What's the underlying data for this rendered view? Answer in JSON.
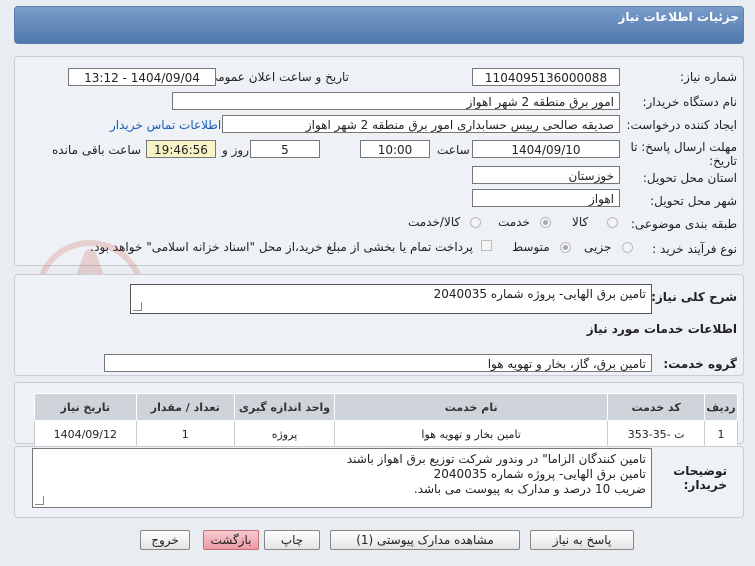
{
  "header": {
    "title": "جزئیات اطلاعات نیاز"
  },
  "form": {
    "need_number_label": "شماره نیاز:",
    "need_number": "1104095136000088",
    "announce_label": "تاریخ و ساعت اعلان عمومی:",
    "announce_value": "1404/09/04 - 13:12",
    "buyer_org_label": "نام دستگاه خریدار:",
    "buyer_org": "امور برق منطقه 2 شهر اهواز",
    "creator_label": "ایجاد کننده درخواست:",
    "creator": "صدیقه صالحی رییس حسابداری امور برق منطقه 2 شهر اهواز",
    "contact_link": "اطلاعات تماس خریدار",
    "deadline_label_1": "مهلت ارسال پاسخ: تا",
    "deadline_label_2": "تاریخ:",
    "deadline_date": "1404/09/10",
    "time_label": "ساعت",
    "deadline_time": "10:00",
    "days_value": "5",
    "days_label": "روز و",
    "remaining_time": "19:46:56",
    "remaining_label": "ساعت باقی مانده",
    "province_label": "استان محل تحویل:",
    "province": "خوزستان",
    "city_label": "شهر محل تحویل:",
    "city": "اهواز",
    "category_label": "طبقه بندی موضوعی:",
    "category_options": [
      "کالا",
      "خدمت",
      "کالا/خدمت"
    ],
    "purchase_type_label": "نوع فرآیند خرید :",
    "purchase_options": [
      "جزیی",
      "متوسط"
    ],
    "payment_note": "پرداخت تمام یا بخشی از مبلغ خرید،از محل \"اسناد خزانه اسلامی\" خواهد بود."
  },
  "description": {
    "label": "شرح کلی نیاز:",
    "value": "تامین برق الهایی- پروژه شماره 2040035"
  },
  "services": {
    "section_title": "اطلاعات خدمات مورد نیاز",
    "group_label": "گروه خدمت:",
    "group_value": "تامین برق، گاز، بخار و تهویه هوا",
    "columns": [
      "ردیف",
      "کد خدمت",
      "نام خدمت",
      "واحد اندازه گیری",
      "تعداد / مقدار",
      "تاریخ نیاز"
    ],
    "rows": [
      [
        "1",
        "ت -35-353",
        "تامین بخار و تهویه هوا",
        "پروژه",
        "1",
        "1404/09/12"
      ]
    ]
  },
  "buyer_notes": {
    "label_1": "توضیحات",
    "label_2": "خریدار:",
    "lines": [
      "تامین کنندگان الزاما\" در وندور شرکت توزیع برق اهواز باشند",
      "تامین برق الهایی- پروژه شماره 2040035",
      "ضریب 10 درصد و مدارک به پیوست می باشد."
    ]
  },
  "buttons": {
    "respond": "پاسخ به نیاز",
    "view_docs": "مشاهده مدارک پیوستی (1)",
    "print": "چاپ",
    "back": "بازگشت",
    "exit": "خروج"
  },
  "colors": {
    "header": "#5a7fb0",
    "link": "#1a5fb4",
    "exit_button": "#ee9ba6"
  }
}
